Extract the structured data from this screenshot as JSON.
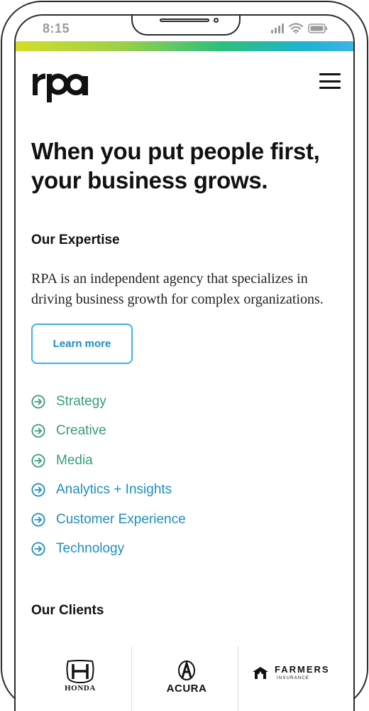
{
  "status_bar": {
    "time": "8:15"
  },
  "header": {
    "logo_text": "rpa",
    "menu_icon": "hamburger-menu-icon"
  },
  "hero": {
    "title": "When you put people first, your business grows."
  },
  "expertise": {
    "heading": "Our Expertise",
    "description": "RPA is an independent agency that specializes in driving business growth for complex organizations.",
    "cta_label": "Learn more",
    "services": [
      {
        "label": "Strategy",
        "color": "#3a9a7a"
      },
      {
        "label": "Creative",
        "color": "#3a9a7a"
      },
      {
        "label": "Media",
        "color": "#3a9a7a"
      },
      {
        "label": "Analytics + Insights",
        "color": "#1e8fbd"
      },
      {
        "label": "Customer Experience",
        "color": "#1e8fbd"
      },
      {
        "label": "Technology",
        "color": "#1e8fbd"
      }
    ]
  },
  "clients": {
    "heading": "Our Clients",
    "logos": [
      {
        "name": "HONDA"
      },
      {
        "name": "ACURA"
      },
      {
        "name": "FARMERS",
        "subtitle": "INSURANCE"
      }
    ]
  },
  "colors": {
    "accent_blue": "#3fb1e3",
    "text_dark": "#111111",
    "status_gray": "#9a9a9a"
  }
}
